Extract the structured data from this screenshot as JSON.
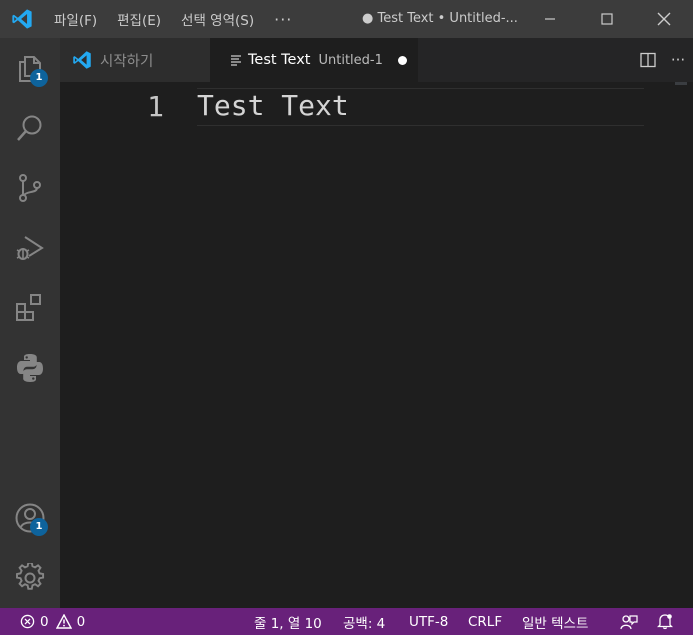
{
  "titlebar": {
    "menu": [
      {
        "label": "파일(F)"
      },
      {
        "label": "편집(E)"
      },
      {
        "label": "선택 영역(S)"
      }
    ],
    "more": "···",
    "window_title": "● Test Text • Untitled-..."
  },
  "activitybar": {
    "explorer_badge": "1",
    "accounts_badge": "1"
  },
  "tabs": [
    {
      "label": "시작하기",
      "description": ""
    },
    {
      "label": "Test Text",
      "description": "Untitled-1"
    }
  ],
  "tab_actions": {
    "more": "···"
  },
  "editor": {
    "lines": [
      {
        "number": "1",
        "text": "Test Text"
      }
    ]
  },
  "statusbar": {
    "errors": "0",
    "warnings": "0",
    "position": "줄 1, 열 10",
    "indent": "공백: 4",
    "encoding": "UTF-8",
    "eol": "CRLF",
    "language": "일반 텍스트"
  },
  "colors": {
    "accent": "#68217a",
    "badge": "#0e639c",
    "vscode_blue": "#23a9f2"
  }
}
